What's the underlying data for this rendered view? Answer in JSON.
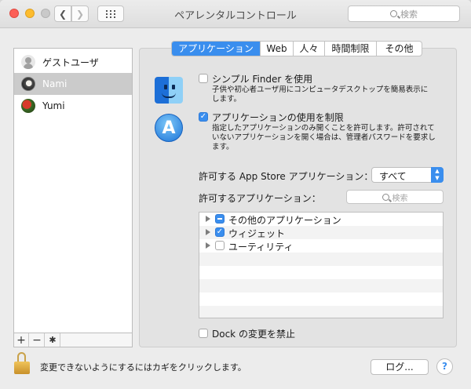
{
  "window": {
    "title": "ペアレンタルコントロール",
    "search_placeholder": "検索"
  },
  "users": [
    {
      "name": "ゲストユーザ",
      "selected": false
    },
    {
      "name": "Nami",
      "selected": true
    },
    {
      "name": "Yumi",
      "selected": false
    }
  ],
  "list_footer": {
    "add": "+",
    "remove": "−",
    "gear": "✱"
  },
  "tabs": [
    {
      "label": "アプリケーション",
      "active": true
    },
    {
      "label": "Web",
      "active": false
    },
    {
      "label": "人々",
      "active": false
    },
    {
      "label": "時間制限",
      "active": false
    },
    {
      "label": "その他",
      "active": false
    }
  ],
  "simple_finder": {
    "label": "シンプル Finder を使用",
    "checked": false,
    "desc_line1": "子供や初心者ユーザ用にコンピュータデスクトップを簡易表示に",
    "desc_line2": "します。"
  },
  "limit_apps": {
    "label": "アプリケーションの使用を制限",
    "checked": true,
    "desc_line1": "指定したアプリケーションのみ開くことを許可します。許可されて",
    "desc_line2": "いないアプリケーションを開く場合は、管理者パスワードを要求し",
    "desc_line3": "ます。"
  },
  "appstore": {
    "label": "許可する App Store アプリケーション：",
    "value": "すべて"
  },
  "allowed_apps": {
    "label": "許可するアプリケーション：",
    "search_placeholder": "検索",
    "items": [
      {
        "label": "その他のアプリケーション",
        "state": "mixed"
      },
      {
        "label": "ウィジェット",
        "state": "checked"
      },
      {
        "label": "ユーティリティ",
        "state": "unchecked"
      }
    ]
  },
  "dock": {
    "label": "Dock の変更を禁止",
    "checked": false
  },
  "footer": {
    "lock_text": "変更できないようにするにはカギをクリックします。",
    "log_button": "ログ...",
    "help_button": "?"
  }
}
